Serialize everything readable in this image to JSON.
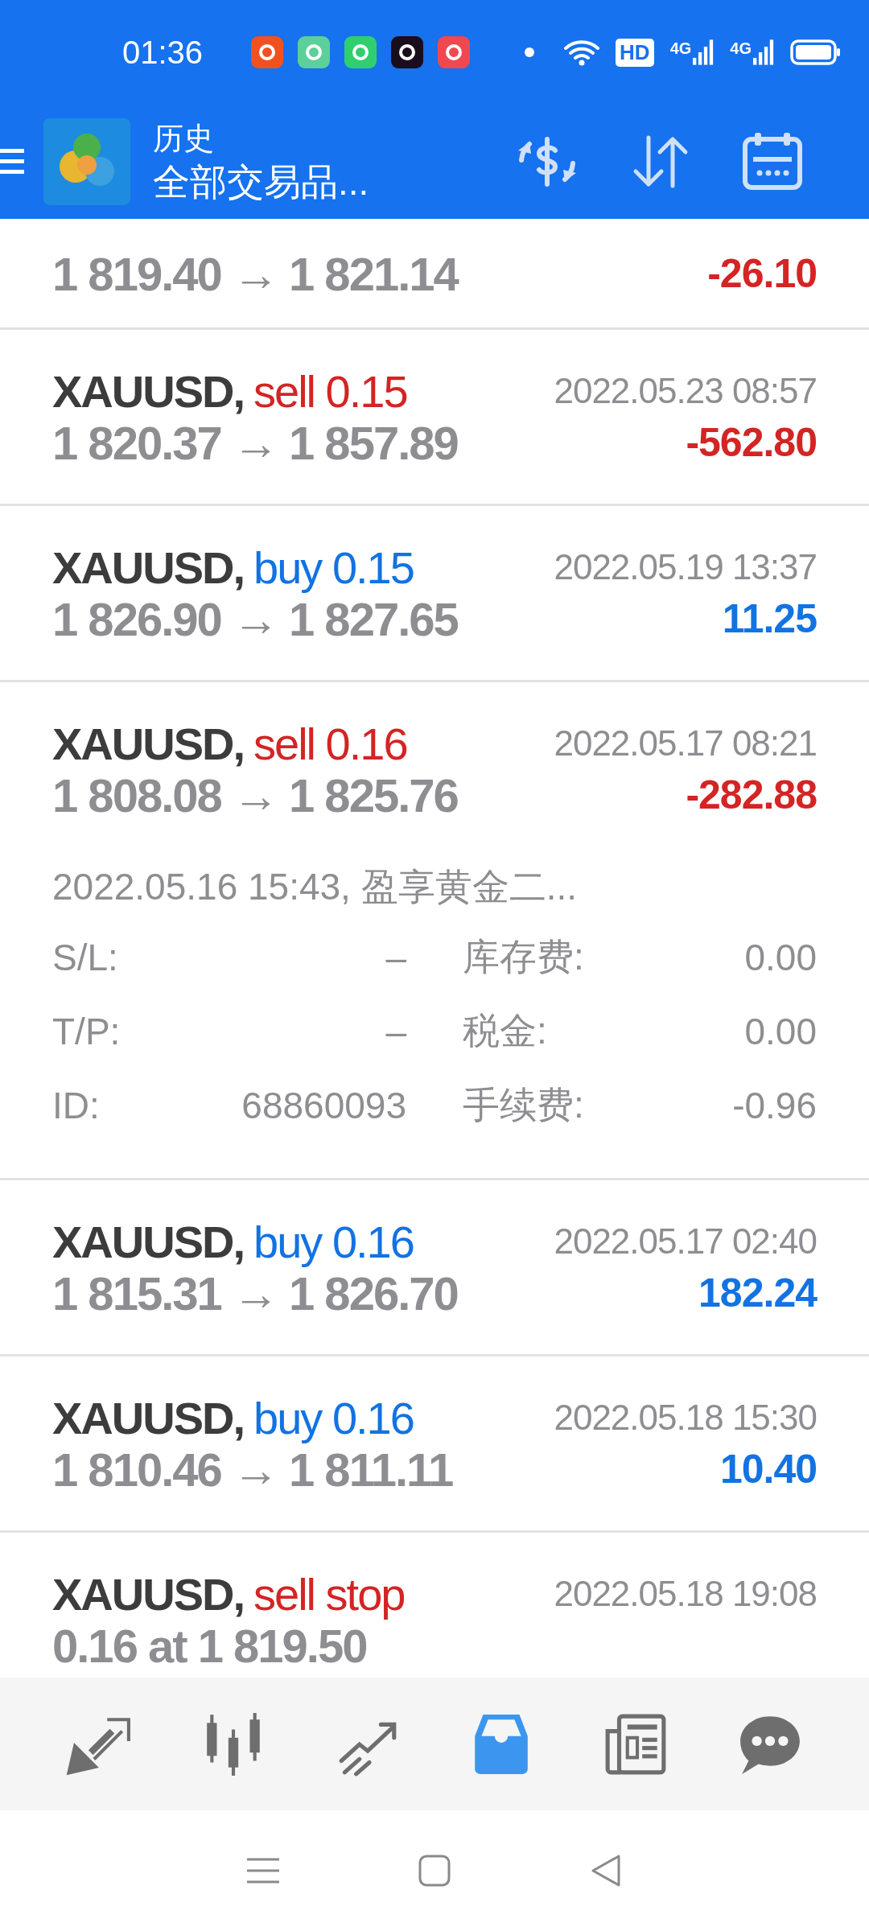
{
  "status_bar": {
    "time": "01:36",
    "hd_label": "HD",
    "network_labels": [
      "4G",
      "4G"
    ]
  },
  "header": {
    "title": "历史",
    "subtitle": "全部交易品..."
  },
  "trades": [
    {
      "kind": "partial",
      "color": "#d42424",
      "prices": "1 819.40 → 1 821.14",
      "profit": "-26.10"
    },
    {
      "kind": "deal",
      "color": "#d42424",
      "symbol": "XAUUSD,",
      "action": "sell 0.15",
      "time": "2022.05.23 08:57",
      "prices": "1 820.37 → 1 857.89",
      "profit": "-562.80"
    },
    {
      "kind": "deal",
      "color": "#1273e2",
      "symbol": "XAUUSD,",
      "action": "buy 0.15",
      "time": "2022.05.19 13:37",
      "prices": "1 826.90 → 1 827.65",
      "profit": "11.25"
    },
    {
      "kind": "deal",
      "color": "#d42424",
      "symbol": "XAUUSD,",
      "action": "sell 0.16",
      "time": "2022.05.17 08:21",
      "prices": "1 808.08 → 1 825.76",
      "profit": "-282.88",
      "details": {
        "open": "2022.05.16 15:43, 盈享黄金二...",
        "fields": [
          {
            "label": "S/L:",
            "value": "–"
          },
          {
            "label": "库存费:",
            "value": "0.00"
          },
          {
            "label": "T/P:",
            "value": "–"
          },
          {
            "label": "税金:",
            "value": "0.00"
          },
          {
            "label": "ID:",
            "value": "68860093"
          },
          {
            "label": "手续费:",
            "value": "-0.96"
          }
        ]
      }
    },
    {
      "kind": "deal",
      "color": "#1273e2",
      "symbol": "XAUUSD,",
      "action": "buy 0.16",
      "time": "2022.05.17 02:40",
      "prices": "1 815.31 → 1 826.70",
      "profit": "182.24"
    },
    {
      "kind": "deal",
      "color": "#1273e2",
      "symbol": "XAUUSD,",
      "action": "buy 0.16",
      "time": "2022.05.18 15:30",
      "prices": "1 810.46 → 1 811.11",
      "profit": "10.40"
    },
    {
      "kind": "order",
      "color": "#d42424",
      "symbol": "XAUUSD,",
      "action": "sell stop",
      "time": "2022.05.18 19:08",
      "prices": "0.16 at 1 819.50"
    }
  ],
  "bottom_nav": [
    {
      "kind": "quotes",
      "selected": false
    },
    {
      "kind": "chart",
      "selected": false
    },
    {
      "kind": "trade",
      "selected": false
    },
    {
      "kind": "history",
      "selected": true
    },
    {
      "kind": "news",
      "selected": false
    },
    {
      "kind": "chat",
      "selected": false
    }
  ]
}
